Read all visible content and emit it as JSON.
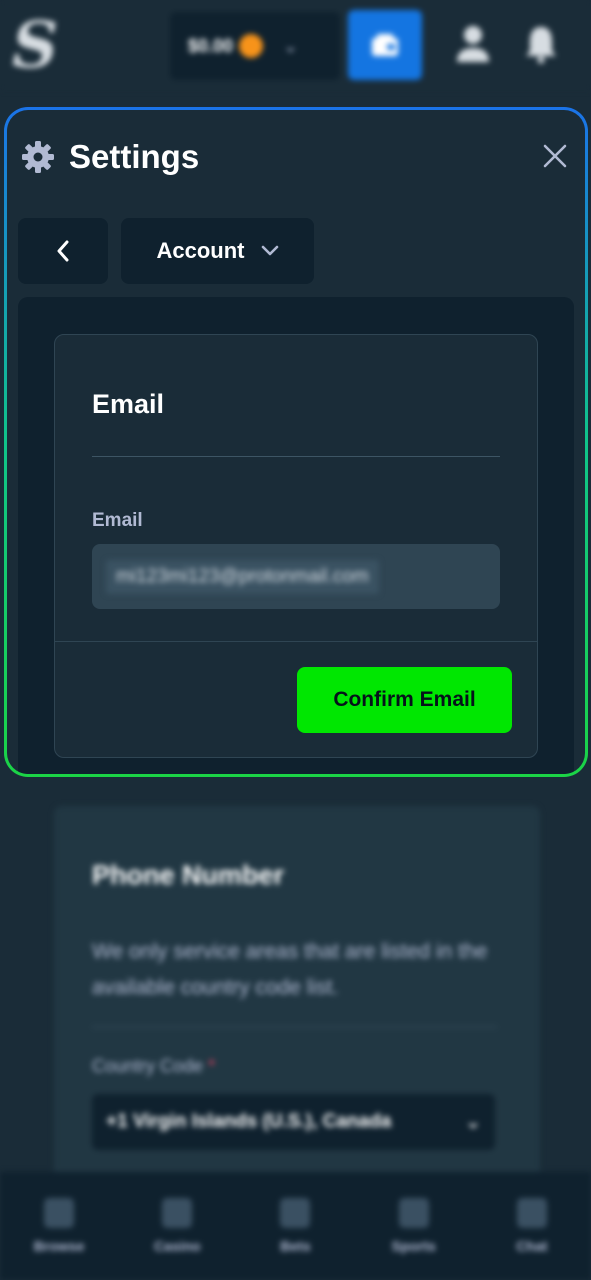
{
  "header": {
    "logo_text": "S",
    "wallet_balance": "$0.00",
    "icons": [
      "coin-icon",
      "chevron-down-icon",
      "wallet-icon",
      "user-icon",
      "bell-icon"
    ]
  },
  "modal": {
    "title": "Settings",
    "section_dropdown": "Account",
    "icons": [
      "gear-icon",
      "close-icon",
      "chevron-left-icon",
      "chevron-down-icon"
    ],
    "email_card": {
      "title": "Email",
      "field_label": "Email",
      "field_value": "mi123mi123@protonmail.com",
      "confirm_label": "Confirm Email"
    }
  },
  "background": {
    "phone_title": "Phone Number",
    "phone_description": "We only service areas that are listed in the available country code list.",
    "country_code_label": "Country Code",
    "country_code_required": "*",
    "country_code_value": "+1 Virgin Islands (U.S.), Canada"
  },
  "bottom_nav": {
    "items": [
      {
        "label": "Browse",
        "icon": "browse-icon"
      },
      {
        "label": "Casino",
        "icon": "casino-icon"
      },
      {
        "label": "Bets",
        "icon": "bets-icon"
      },
      {
        "label": "Sports",
        "icon": "sports-icon"
      },
      {
        "label": "Chat",
        "icon": "chat-icon"
      }
    ]
  },
  "colors": {
    "background": "#1a2c38",
    "panel_dark": "#0f212e",
    "accent_green": "#00e701",
    "accent_blue": "#1475e1",
    "muted_text": "#b1bad3"
  }
}
